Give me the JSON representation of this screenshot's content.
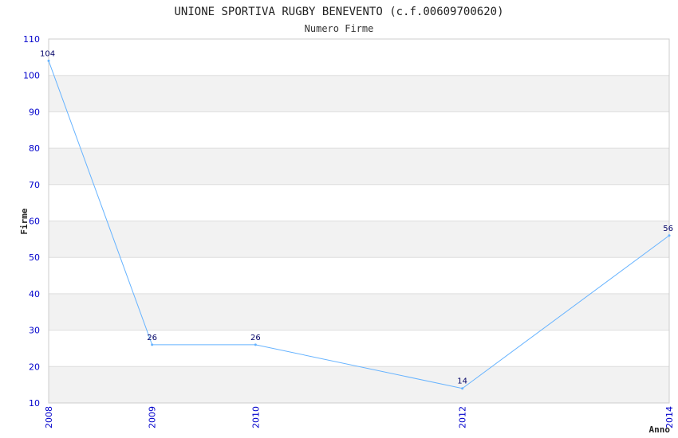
{
  "chart_data": {
    "type": "line",
    "title": "UNIONE SPORTIVA RUGBY BENEVENTO (c.f.00609700620)",
    "subtitle": "Numero Firme",
    "xlabel": "Anno",
    "ylabel": "Firme",
    "x": [
      "2008",
      "2009",
      "2010",
      "2012",
      "2014"
    ],
    "xlim": [
      2008,
      2014
    ],
    "ylim": [
      10,
      110
    ],
    "yticks": [
      10,
      20,
      30,
      40,
      50,
      60,
      70,
      80,
      90,
      100,
      110
    ],
    "series": [
      {
        "values": [
          104,
          26,
          26,
          14,
          56
        ]
      }
    ],
    "data_labels": [
      "104",
      "26",
      "26",
      "14",
      "56"
    ],
    "grid": true,
    "colors": {
      "line": "#66b3ff",
      "band_alt": "#f2f2f2",
      "grid": "#dddddd",
      "tick": "#0000cc",
      "data_label": "#000066"
    }
  }
}
